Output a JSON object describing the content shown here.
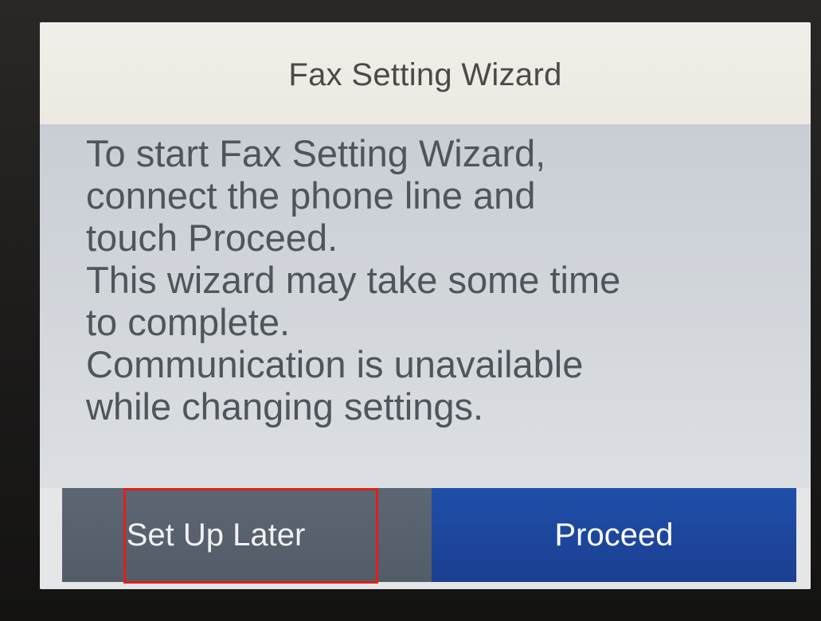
{
  "dialog": {
    "title": "Fax Setting Wizard",
    "message": "To start Fax Setting Wizard,\nconnect the phone line and\ntouch Proceed.\nThis wizard may take some time\nto complete.\nCommunication is unavailable\nwhile changing settings."
  },
  "buttons": {
    "set_up_later_label": "Set Up Later",
    "proceed_label": "Proceed"
  },
  "colors": {
    "proceed_button": "#1f4fa8",
    "set_up_later_button": "#5d6673",
    "highlight": "#e0201a"
  }
}
